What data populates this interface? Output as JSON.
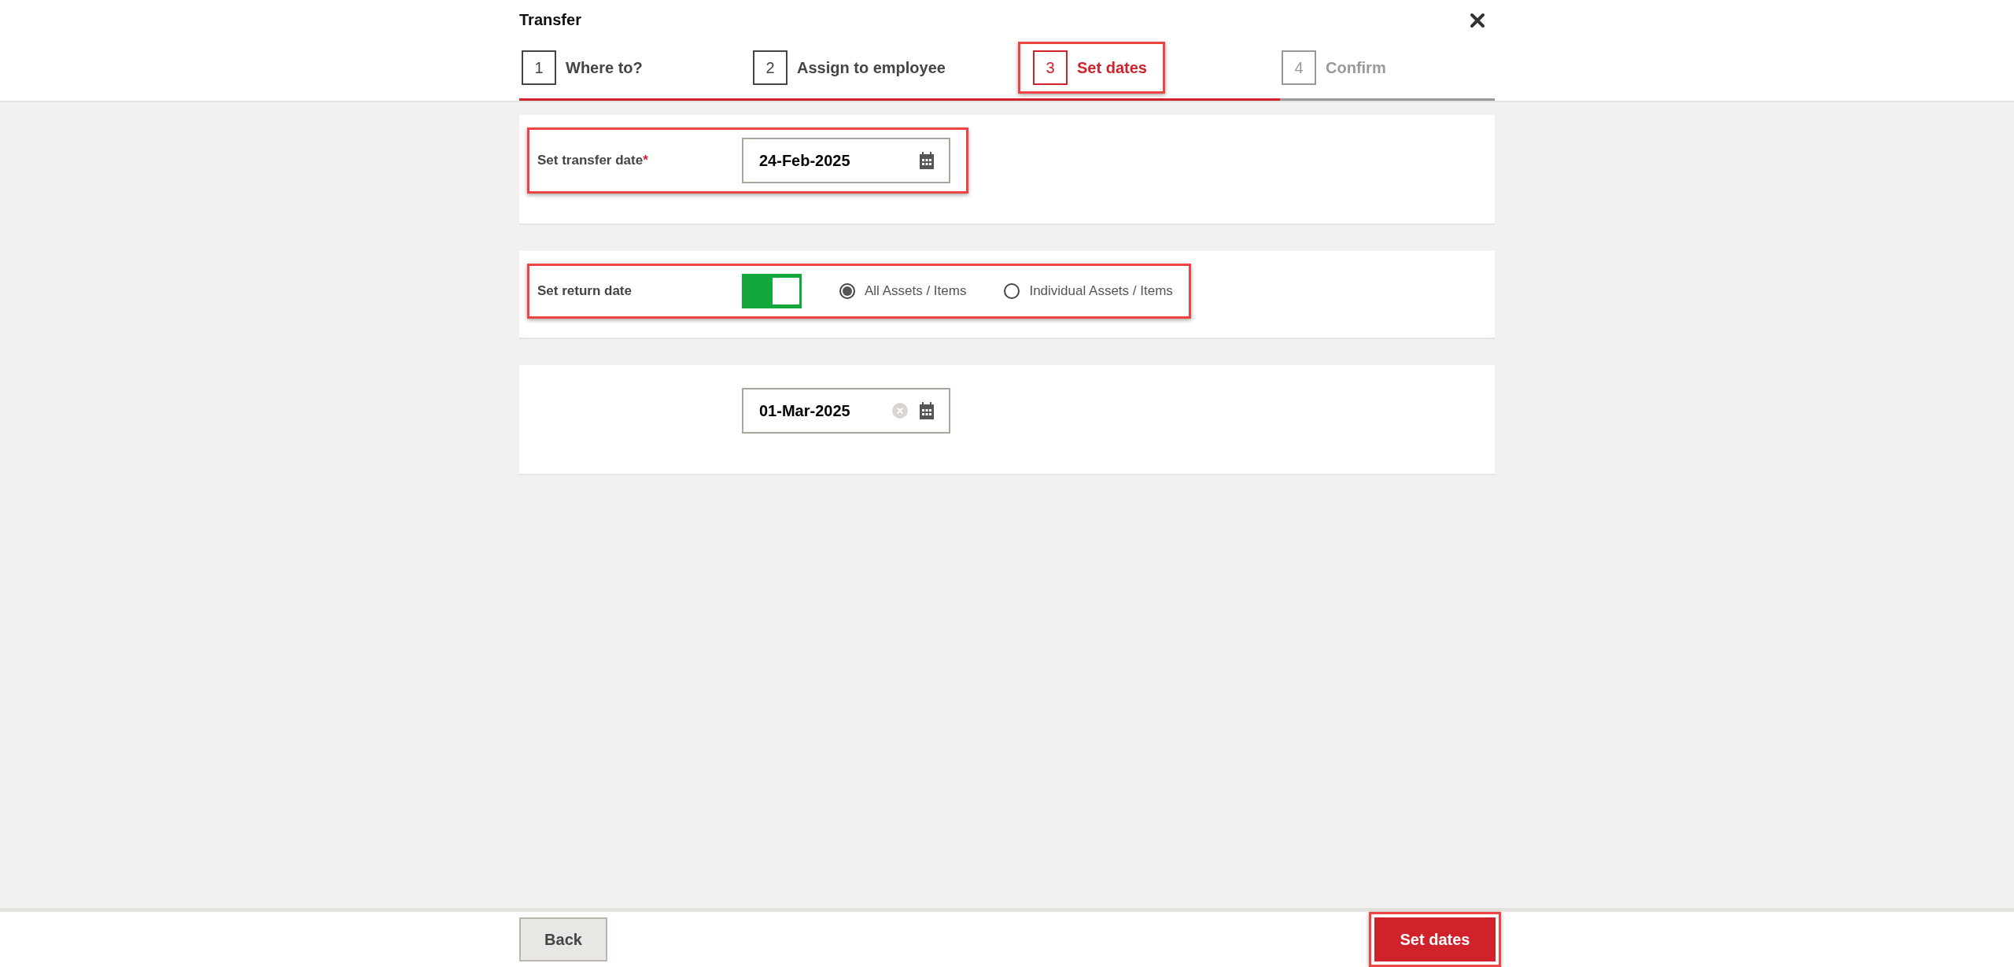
{
  "dialog": {
    "title": "Transfer"
  },
  "steps": [
    {
      "number": "1",
      "label": "Where to?",
      "selected": false,
      "disabled": false,
      "highlighted": false
    },
    {
      "number": "2",
      "label": "Assign to employee",
      "selected": false,
      "disabled": false,
      "highlighted": false
    },
    {
      "number": "3",
      "label": "Set dates",
      "selected": true,
      "disabled": false,
      "highlighted": true
    },
    {
      "number": "4",
      "label": "Confirm",
      "selected": false,
      "disabled": true,
      "highlighted": false
    }
  ],
  "progress": {
    "level": 0.78
  },
  "transfer_date": {
    "label": "Set transfer date",
    "required_mark": "*",
    "value": "24-Feb-2025",
    "highlighted": true
  },
  "return_date": {
    "label": "Set return date",
    "on": true,
    "highlighted": true,
    "options": [
      {
        "label": "All Assets / Items",
        "selected": true
      },
      {
        "label": "Individual Assets / Items",
        "selected": false
      }
    ]
  },
  "return_date_field": {
    "value": "01-Mar-2025",
    "clearable": true
  },
  "footer": {
    "back": {
      "label": "Back"
    },
    "submit": {
      "label": "Set dates",
      "highlighted": true
    }
  }
}
